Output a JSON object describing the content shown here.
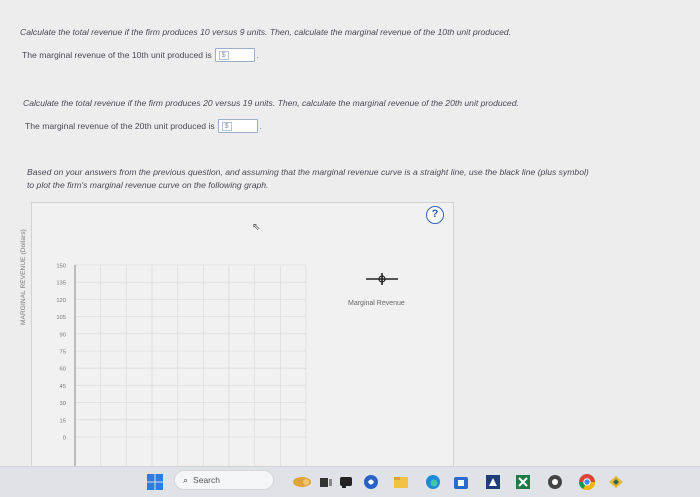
{
  "questions": {
    "q1": {
      "prompt": "Calculate the total revenue if the firm produces 10 versus 9 units. Then, calculate the marginal revenue of the 10th unit produced.",
      "answer_label": "The marginal revenue of the 10th unit produced is",
      "answer_prefix": "$",
      "trailing": "."
    },
    "q2": {
      "prompt": "Calculate the total revenue if the firm produces 20 versus 19 units. Then, calculate the marginal revenue of the 20th unit produced.",
      "answer_label": "The marginal revenue of the 20th unit produced is",
      "answer_prefix": "$",
      "trailing": "."
    },
    "q3": {
      "prompt_line1": "Based on your answers from the previous question, and assuming that the marginal revenue curve is a straight line, use the black line (plus symbol)",
      "prompt_line2": "to plot the firm's marginal revenue curve on the following graph."
    }
  },
  "graph": {
    "help_glyph": "?",
    "y_axis_title": "MARGINAL REVENUE (Dollars)",
    "legend_label": "Marginal Revenue",
    "tool_color": "#222222",
    "grid_color": "#dcdcdc"
  },
  "chart_data": {
    "type": "line",
    "title": "",
    "xlabel": "",
    "ylabel": "MARGINAL REVENUE (Dollars)",
    "y_ticks": [
      0,
      15,
      30,
      45,
      60,
      75,
      90,
      105,
      120,
      135,
      150
    ],
    "ylim": [
      0,
      150
    ],
    "series": [],
    "grid": true,
    "legend": "right"
  },
  "taskbar": {
    "search_label": "Search",
    "search_icon": "search-icon",
    "apps": [
      "windows-start-icon",
      "widgets-icon",
      "task-view-icon",
      "chat-icon",
      "file-explorer-icon",
      "edge-icon",
      "store-icon",
      "app-icon",
      "excel-icon",
      "media-icon",
      "chrome-icon",
      "app-icon-2"
    ]
  }
}
